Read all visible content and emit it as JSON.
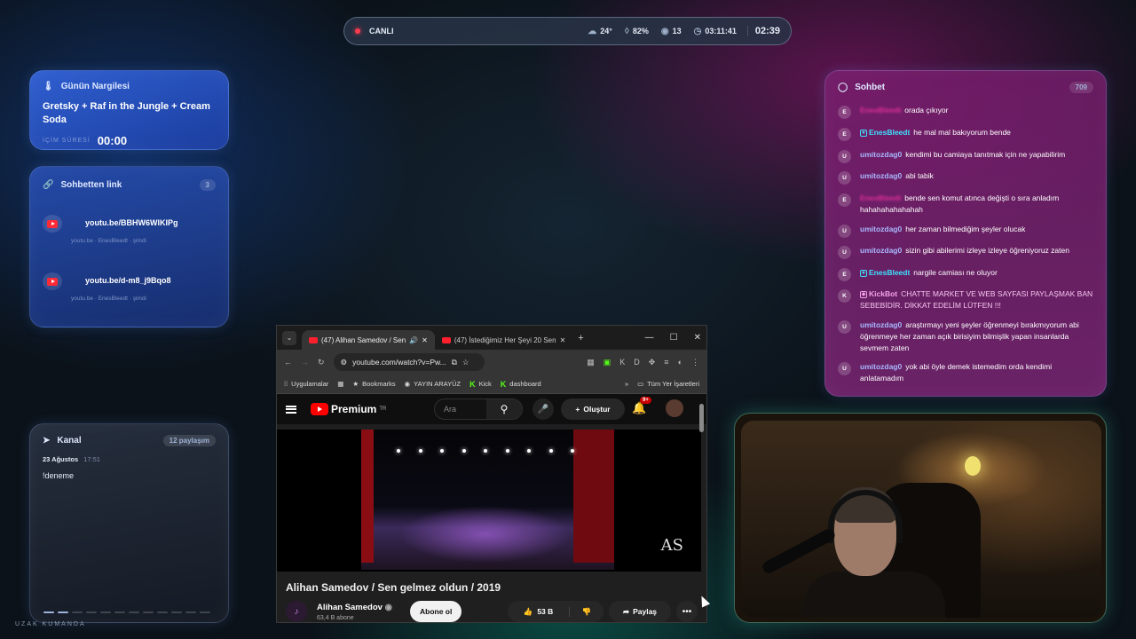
{
  "topbar": {
    "live": "CANLI",
    "temp": "24°",
    "humidity": "82%",
    "viewers": "13",
    "uptime": "03:11:41",
    "clock": "02:39"
  },
  "nargile": {
    "title": "Günün Nargilesi",
    "body": "Gretsky + Raf in the Jungle + Cream Soda",
    "time_label": "İÇİM SÜRESİ",
    "time_value": "00:00"
  },
  "links": {
    "title": "Sohbetten link",
    "count": "3",
    "items": [
      {
        "url": "youtu.be/BBHW6WlKIPg",
        "meta": "youtu.be · EnesBleedt · şimdi"
      },
      {
        "url": "youtu.be/d-m8_j9Bqo8",
        "meta": "youtu.be · EnesBleedt · şimdi"
      }
    ]
  },
  "kanal": {
    "title": "Kanal",
    "count": "12 paylaşım",
    "date": "23 Ağustos",
    "time": "17:51",
    "message": "!deneme",
    "footer": "UZAK KUMANDA"
  },
  "chat": {
    "title": "Sohbet",
    "count": "709",
    "messages": [
      {
        "initial": "E",
        "user": "EnesBleedt",
        "text": "orada çıkıyor"
      },
      {
        "initial": "E",
        "user": "EnesBleedt",
        "text": "he mal mal bakıyorum bende"
      },
      {
        "initial": "U",
        "user": "umitozdag0",
        "text": "kendimi bu camiaya tanıtmak için ne yapabilirim"
      },
      {
        "initial": "U",
        "user": "umitozdag0",
        "text": "abi tabik"
      },
      {
        "initial": "E",
        "user": "EnesBleedt",
        "text": "bende sen komut atınca değişti o sıra anladım hahahahahahahah"
      },
      {
        "initial": "U",
        "user": "umitozdag0",
        "text": "her zaman bilmediğim şeyler olucak"
      },
      {
        "initial": "U",
        "user": "umitozdag0",
        "text": "sizin gibi abilerimi izleye izleye öğreniyoruz zaten"
      },
      {
        "initial": "E",
        "user": "EnesBleedt",
        "text": "nargile camiası ne oluyor"
      },
      {
        "initial": "K",
        "user": "KickBot",
        "text": "CHATTE MARKET VE WEB SAYFASI PAYLAŞMAK BAN SEBEBİDİR. DİKKAT EDELİM LÜTFEN !!!"
      },
      {
        "initial": "U",
        "user": "umitozdag0",
        "text": "araştırmayı yeni şeyler öğrenmeyi bırakmıyorum abi öğrenmeye her zaman açık birisiyim bilmişlik yapan insanlarda sevmem zaten"
      },
      {
        "initial": "U",
        "user": "umitozdag0",
        "text": "yok abi öyle demek istemedim orda kendimi anlatamadım"
      }
    ]
  },
  "browser": {
    "tab1": "(47) Alihan Samedov / Sen",
    "tab2": "(47) İstediğimiz Her Şeyi 20 Sen",
    "url": "youtube.com/watch?v=Pw...",
    "bookmarks": [
      "Uygulamalar",
      "Bookmarks",
      "YAYIN ARAYÜZ",
      "Kick",
      "dashboard",
      "Tüm Yer İşaretleri"
    ],
    "yt_brand": "Premium",
    "yt_region": "TR",
    "search_placeholder": "Ara",
    "create": "Oluştur",
    "notif_count": "9+",
    "watermark": "AS",
    "video_title": "Alihan Samedov / Sen gelmez oldun / 2019",
    "channel": "Alihan Samedov",
    "subs": "63,4 B abone",
    "subscribe": "Abone ol",
    "likes": "53 B",
    "share": "Paylaş"
  }
}
